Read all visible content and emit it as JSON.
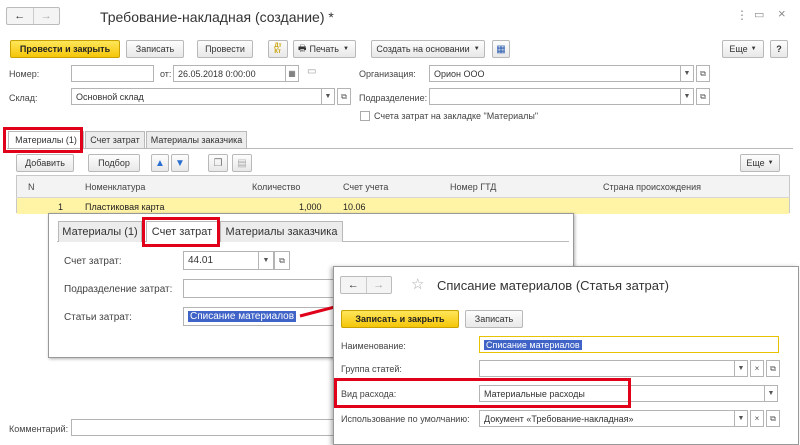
{
  "window": {
    "title": "Требование-накладная (создание) *",
    "nav_back": "←",
    "nav_forward": "→",
    "star": "☆"
  },
  "toolbar": {
    "post_close": "Провести и закрыть",
    "save": "Записать",
    "post": "Провести",
    "dtkt": "Дт\nКт",
    "print": "Печать",
    "create_basis": "Создать на основании",
    "more": "Еще"
  },
  "header": {
    "number_label": "Номер:",
    "number_value": "",
    "from_label": "от:",
    "date_value": "26.05.2018  0:00:00",
    "org_label": "Организация:",
    "org_value": "Орион ООО",
    "warehouse_label": "Склад:",
    "warehouse_value": "Основной склад",
    "division_label": "Подразделение:",
    "division_value": "",
    "checkbox_label": "Счета затрат на закладке \"Материалы\""
  },
  "tabs": [
    "Материалы (1)",
    "Счет затрат",
    "Материалы заказчика"
  ],
  "table_toolbar": {
    "add": "Добавить",
    "pick": "Подбор",
    "more": "Еще"
  },
  "table": {
    "columns": [
      "N",
      "Номенклатура",
      "Количество",
      "Счет учета",
      "Номер ГТД",
      "Страна происхождения"
    ],
    "rows": [
      {
        "n": "1",
        "nomenclature": "Пластиковая карта",
        "qty": "1,000",
        "account": "10.06",
        "gtd": "",
        "country": ""
      }
    ]
  },
  "overlay": {
    "tabs": [
      "Материалы (1)",
      "Счет затрат",
      "Материалы заказчика"
    ],
    "cost_account_label": "Счет затрат:",
    "cost_account_value": "44.01",
    "cost_division_label": "Подразделение затрат:",
    "cost_division_value": "",
    "cost_item_label": "Статьи затрат:",
    "cost_item_value": "Списание материалов"
  },
  "popup": {
    "title": "Списание материалов (Статья затрат)",
    "save_close": "Записать и закрыть",
    "save": "Записать",
    "name_label": "Наименование:",
    "name_value": "Списание материалов",
    "group_label": "Группа статей:",
    "group_value": "",
    "expense_label": "Вид расхода:",
    "expense_value": "Материальные расходы",
    "default_label": "Использование по умолчанию:",
    "default_value": "Документ «Требование-накладная»"
  },
  "footer": {
    "comment_label": "Комментарий:",
    "comment_value": ""
  },
  "colors": {
    "accent_yellow": "#f5c60a",
    "highlight_red": "#e0001a",
    "selection_blue": "#3f63c6",
    "row_yellow": "#fff3a6"
  }
}
